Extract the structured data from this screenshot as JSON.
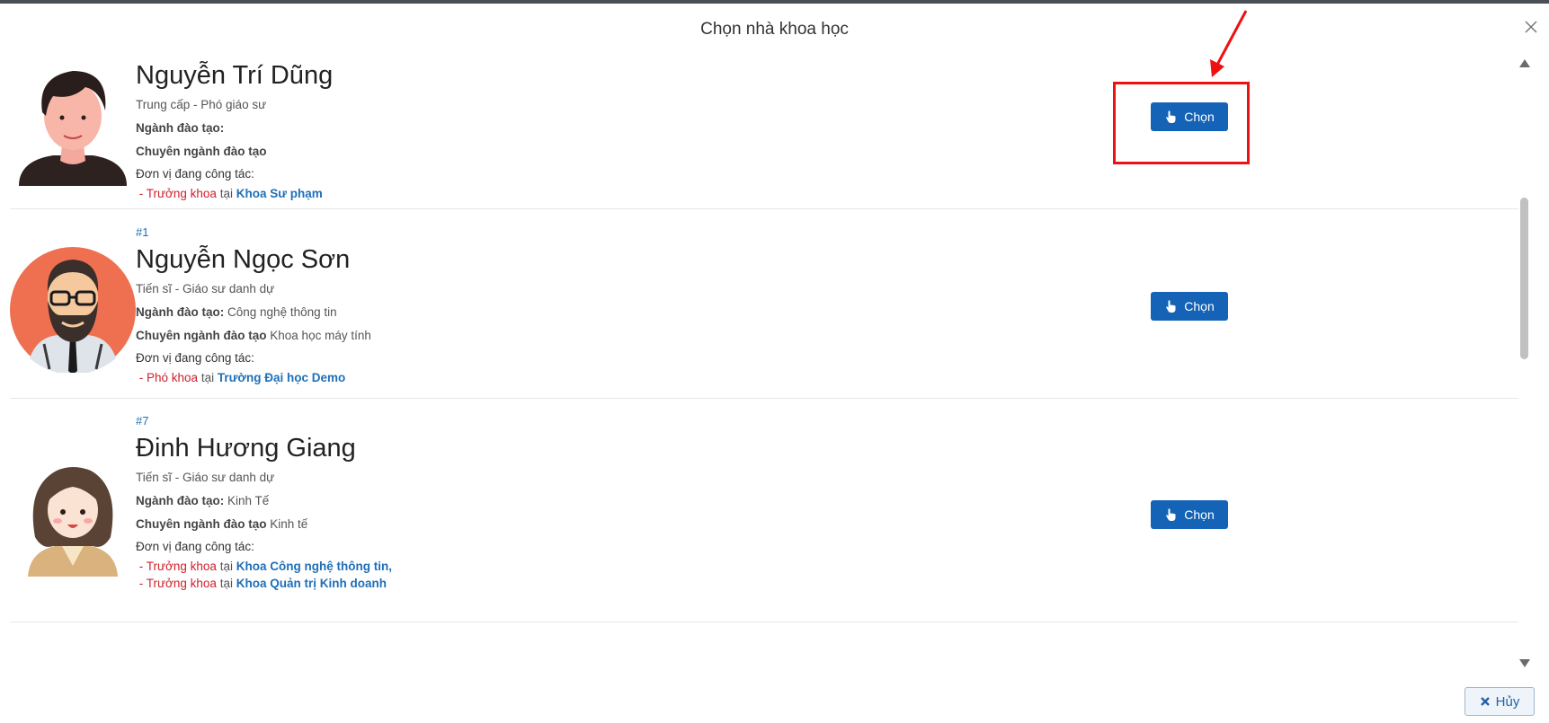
{
  "modal": {
    "title": "Chọn nhà khoa học",
    "cancel_label": "Hủy"
  },
  "labels": {
    "major": "Ngành đào tạo:",
    "specialization": "Chuyên ngành đào tạo",
    "unit": "Đơn vị đang công tác:",
    "at": "tại",
    "choose": "Chọn"
  },
  "scientists": [
    {
      "rank": "",
      "name": "Nguyễn Trí Dũng",
      "degree": "Trung cấp - Phó giáo sư",
      "major": "",
      "specialization": "",
      "positions": [
        {
          "role": "Trưởng khoa",
          "org": "Khoa Sư phạm"
        }
      ]
    },
    {
      "rank": "#1",
      "name": "Nguyễn Ngọc Sơn",
      "degree": "Tiến sĩ - Giáo sư danh dự",
      "major": "Công nghệ thông tin",
      "specialization": "Khoa học máy tính",
      "positions": [
        {
          "role": "Phó khoa",
          "org": "Trường Đại học Demo"
        }
      ]
    },
    {
      "rank": "#7",
      "name": "Đinh Hương Giang",
      "degree": "Tiến sĩ - Giáo sư danh dự",
      "major": "Kinh Tế",
      "specialization": "Kinh tế",
      "positions": [
        {
          "role": "Trưởng khoa",
          "org": "Khoa Công nghệ thông tin,"
        },
        {
          "role": "Trưởng khoa",
          "org": "Khoa Quản trị Kinh doanh"
        }
      ]
    }
  ],
  "colors": {
    "primary_button": "#1563b6",
    "role_red": "#d0202c",
    "link_blue": "#1e6fb8",
    "annotation_red": "#ee1111"
  }
}
